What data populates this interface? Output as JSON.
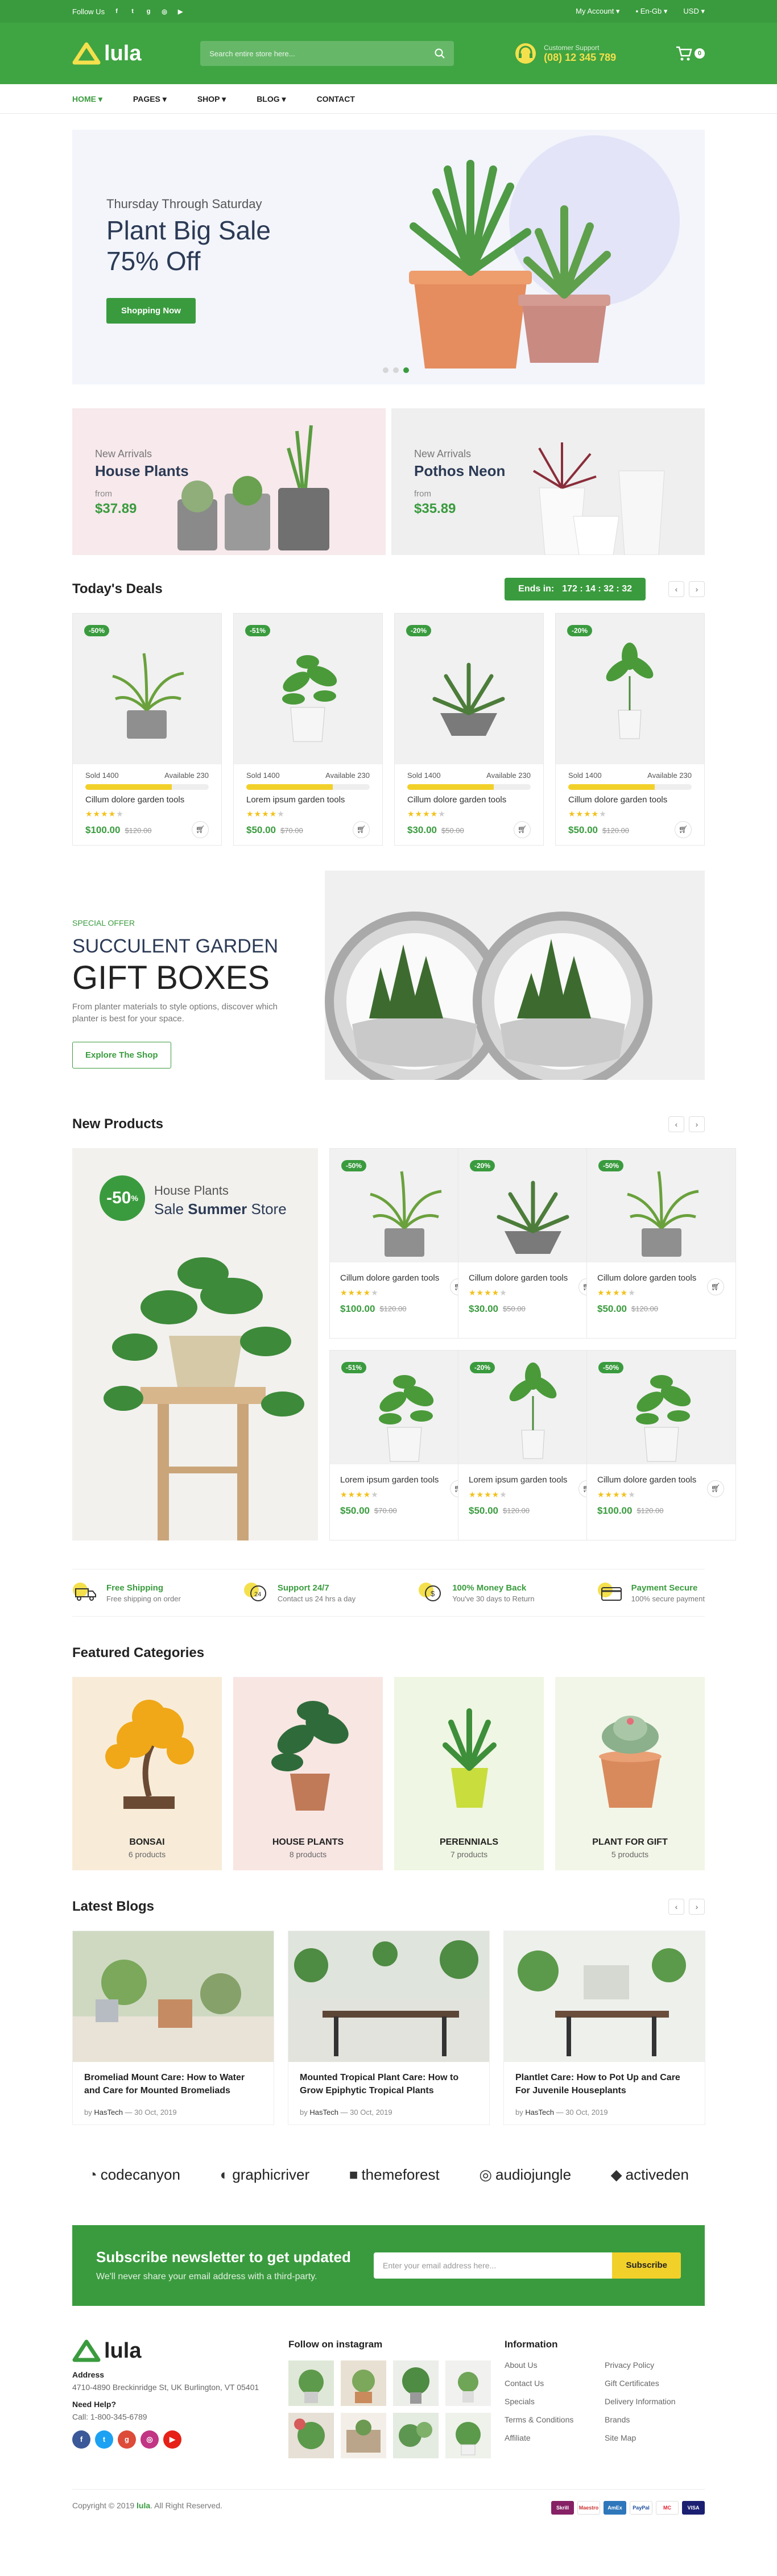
{
  "topbar": {
    "follow_label": "Follow Us",
    "social_icons": [
      "f",
      "t",
      "g",
      "in",
      "yt"
    ],
    "account": "My Account",
    "language": "En-Gb",
    "currency": "USD"
  },
  "header": {
    "logo": "lula",
    "search_placeholder": "Search entire store here...",
    "support_label": "Customer Support",
    "support_phone": "(08) 12 345 789",
    "cart_count": "0"
  },
  "nav": {
    "items": [
      "HOME",
      "PAGES",
      "SHOP",
      "BLOG",
      "CONTACT"
    ]
  },
  "hero": {
    "subtitle": "Thursday Through Saturday",
    "title": "Plant Big Sale",
    "discount": "75% Off",
    "button": "Shopping Now"
  },
  "banners": [
    {
      "label": "New Arrivals",
      "name": "House Plants",
      "from": "from",
      "price": "$37.89"
    },
    {
      "label": "New Arrivals",
      "name": "Pothos Neon",
      "from": "from",
      "price": "$35.89"
    }
  ],
  "deals": {
    "title": "Today's Deals",
    "ends_label": "Ends in:",
    "countdown": "172 : 14 : 32 : 32",
    "items": [
      {
        "badge": "-50%",
        "sold": "Sold 1400",
        "available": "Available 230",
        "progress": 0.7,
        "name": "Cillum dolore garden tools",
        "price": "$100.00",
        "old": "$120.00",
        "rating": 4
      },
      {
        "badge": "-51%",
        "sold": "Sold 1400",
        "available": "Available 230",
        "progress": 0.7,
        "name": "Lorem ipsum garden tools",
        "price": "$50.00",
        "old": "$70.00",
        "rating": 4
      },
      {
        "badge": "-20%",
        "sold": "Sold 1400",
        "available": "Available 230",
        "progress": 0.7,
        "name": "Cillum dolore garden tools",
        "price": "$30.00",
        "old": "$50.00",
        "rating": 4
      },
      {
        "badge": "-20%",
        "sold": "Sold 1400",
        "available": "Available 230",
        "progress": 0.7,
        "name": "Cillum dolore garden tools",
        "price": "$50.00",
        "old": "$120.00",
        "rating": 4
      }
    ]
  },
  "special": {
    "label": "SPECIAL OFFER",
    "line1": "SUCCULENT GARDEN",
    "line2": "GIFT BOXES",
    "desc": "From planter materials to style options, discover which planter is best for your space.",
    "button": "Explore The Shop"
  },
  "new_products": {
    "title": "New Products",
    "promo_badge": "-50",
    "promo_badge_unit": "%",
    "promo_line1": "House Plants",
    "promo_line2_pre": "Sale ",
    "promo_line2_bold": "Summer",
    "promo_line2_post": " Store",
    "items": [
      {
        "badge": "-50%",
        "name": "Cillum dolore garden tools",
        "price": "$100.00",
        "old": "$120.00",
        "rating": 4
      },
      {
        "badge": "-20%",
        "name": "Cillum dolore garden tools",
        "price": "$30.00",
        "old": "$50.00",
        "rating": 4
      },
      {
        "badge": "-50%",
        "name": "Cillum dolore garden tools",
        "price": "$50.00",
        "old": "$120.00",
        "rating": 4
      },
      {
        "badge": "-51%",
        "name": "Lorem ipsum garden tools",
        "price": "$50.00",
        "old": "$70.00",
        "rating": 4
      },
      {
        "badge": "-20%",
        "name": "Lorem ipsum garden tools",
        "price": "$50.00",
        "old": "$120.00",
        "rating": 4
      },
      {
        "badge": "-50%",
        "name": "Cillum dolore garden tools",
        "price": "$100.00",
        "old": "$120.00",
        "rating": 4
      }
    ]
  },
  "features": [
    {
      "title": "Free Shipping",
      "desc": "Free shipping on order"
    },
    {
      "title": "Support 24/7",
      "desc": "Contact us 24 hrs a day"
    },
    {
      "title": "100% Money Back",
      "desc": "You've 30 days to Return"
    },
    {
      "title": "Payment Secure",
      "desc": "100% secure payment"
    }
  ],
  "categories": {
    "title": "Featured Categories",
    "items": [
      {
        "name": "BONSAI",
        "count": "6 products"
      },
      {
        "name": "HOUSE PLANTS",
        "count": "8 products"
      },
      {
        "name": "PERENNIALS",
        "count": "7 products"
      },
      {
        "name": "PLANT FOR GIFT",
        "count": "5 products"
      }
    ]
  },
  "blogs": {
    "title": "Latest Blogs",
    "items": [
      {
        "title": "Bromeliad Mount Care: How to Water and Care for Mounted Bromeliads",
        "by": "by",
        "author": "HasTech",
        "date": "30 Oct, 2019"
      },
      {
        "title": "Mounted Tropical Plant Care: How to Grow Epiphytic Tropical Plants",
        "by": "by",
        "author": "HasTech",
        "date": "30 Oct, 2019"
      },
      {
        "title": "Plantlet Care: How to Pot Up and Care For Juvenile Houseplants",
        "by": "by",
        "author": "HasTech",
        "date": "30 Oct, 2019"
      }
    ]
  },
  "brands": [
    "codecanyon",
    "graphicriver",
    "themeforest",
    "audiojungle",
    "activeden"
  ],
  "newsletter": {
    "title": "Subscribe newsletter to get updated",
    "desc": "We'll never share your email address with a third-party.",
    "placeholder": "Enter your email address here...",
    "button": "Subscribe"
  },
  "footer": {
    "logo": "lula",
    "address_label": "Address",
    "address": "4710-4890 Breckinridge St, UK Burlington, VT 05401",
    "help_label": "Need Help?",
    "call": "Call: 1-800-345-6789",
    "instagram_title": "Follow on instagram",
    "info_title": "Information",
    "links": [
      "About Us",
      "Privacy Policy",
      "Contact Us",
      "Gift Certificates",
      "Specials",
      "Delivery Information",
      "Terms & Conditions",
      "Brands",
      "Affiliate",
      "Site Map"
    ],
    "copyright_pre": "Copyright © 2019",
    "copyright_brand": "lula",
    "copyright_post": ". All Right Reserved.",
    "payments": [
      "Skrill",
      "Maestro",
      "AmEx",
      "PayPal",
      "MC",
      "VISA"
    ]
  },
  "colors": {
    "brand_green": "#3a9b3e",
    "accent_yellow": "#f2d02a"
  }
}
